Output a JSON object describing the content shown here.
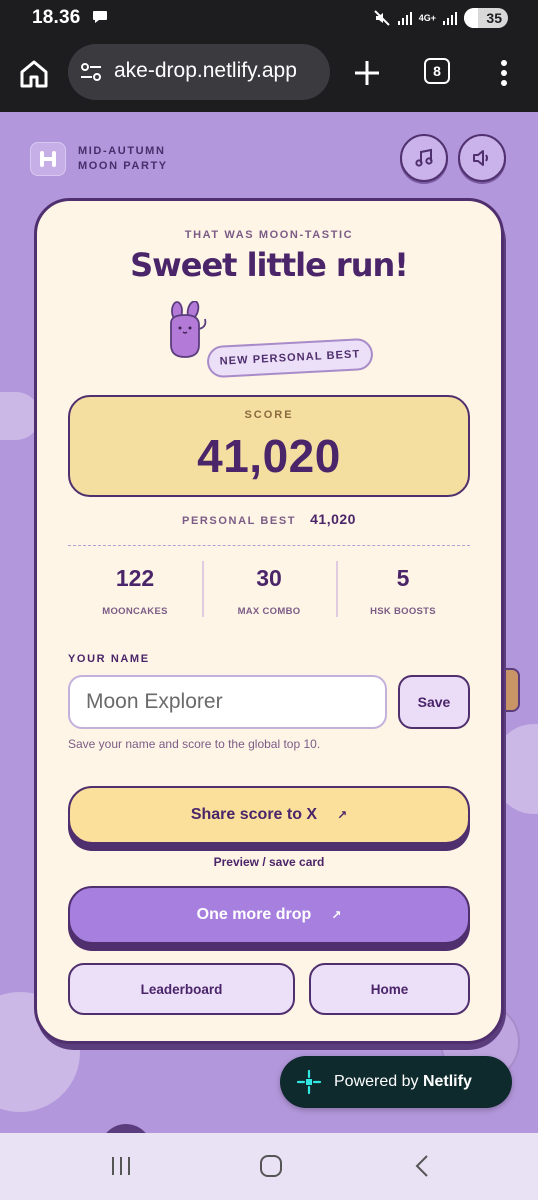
{
  "status_bar": {
    "time": "18.36",
    "network": "4G+",
    "battery": "35"
  },
  "browser": {
    "url": "ake-drop.netlify.app",
    "tab_count": "8"
  },
  "header": {
    "brand_line1": "MID-AUTUMN",
    "brand_line2": "MOON PARTY"
  },
  "result": {
    "kicker": "THAT WAS MOON-TASTIC",
    "headline": "Sweet little run!",
    "badge": "NEW PERSONAL BEST",
    "score_label": "SCORE",
    "score": "41,020",
    "personal_best_label": "PERSONAL BEST",
    "personal_best": "41,020",
    "stats": [
      {
        "value": "122",
        "label": "MOONCAKES"
      },
      {
        "value": "30",
        "label": "MAX COMBO"
      },
      {
        "value": "5",
        "label": "HSK BOOSTS"
      }
    ]
  },
  "name_form": {
    "label": "YOUR NAME",
    "placeholder": "Moon Explorer",
    "value": "",
    "save_label": "Save",
    "help": "Save your name and score to the global top 10."
  },
  "actions": {
    "share_label": "Share score to X",
    "share_arrow": "↗",
    "preview_label": "Preview / save card",
    "drop_label": "One more drop",
    "drop_arrow": "↗",
    "leaderboard_label": "Leaderboard",
    "home_label": "Home"
  },
  "badge_netlify": {
    "prefix": "Powered by",
    "brand": "Netlify"
  },
  "colors": {
    "page_bg": "#b397dc",
    "card_bg": "#fff5e6",
    "ink": "#4a2569",
    "score_bg": "#f4dea0",
    "share_bg": "#fbe09c",
    "drop_bg": "#a77fdf"
  },
  "icons": [
    "chat-bubble-icon",
    "mute-icon",
    "signal-icon",
    "battery-icon",
    "home-icon",
    "site-settings-icon",
    "plus-icon",
    "tabs-icon",
    "overflow-menu-icon",
    "logo-icon",
    "music-note-icon",
    "speaker-icon",
    "bunny-mascot-icon",
    "netlify-logo-icon",
    "recents-icon",
    "home-circle-icon",
    "back-icon"
  ]
}
